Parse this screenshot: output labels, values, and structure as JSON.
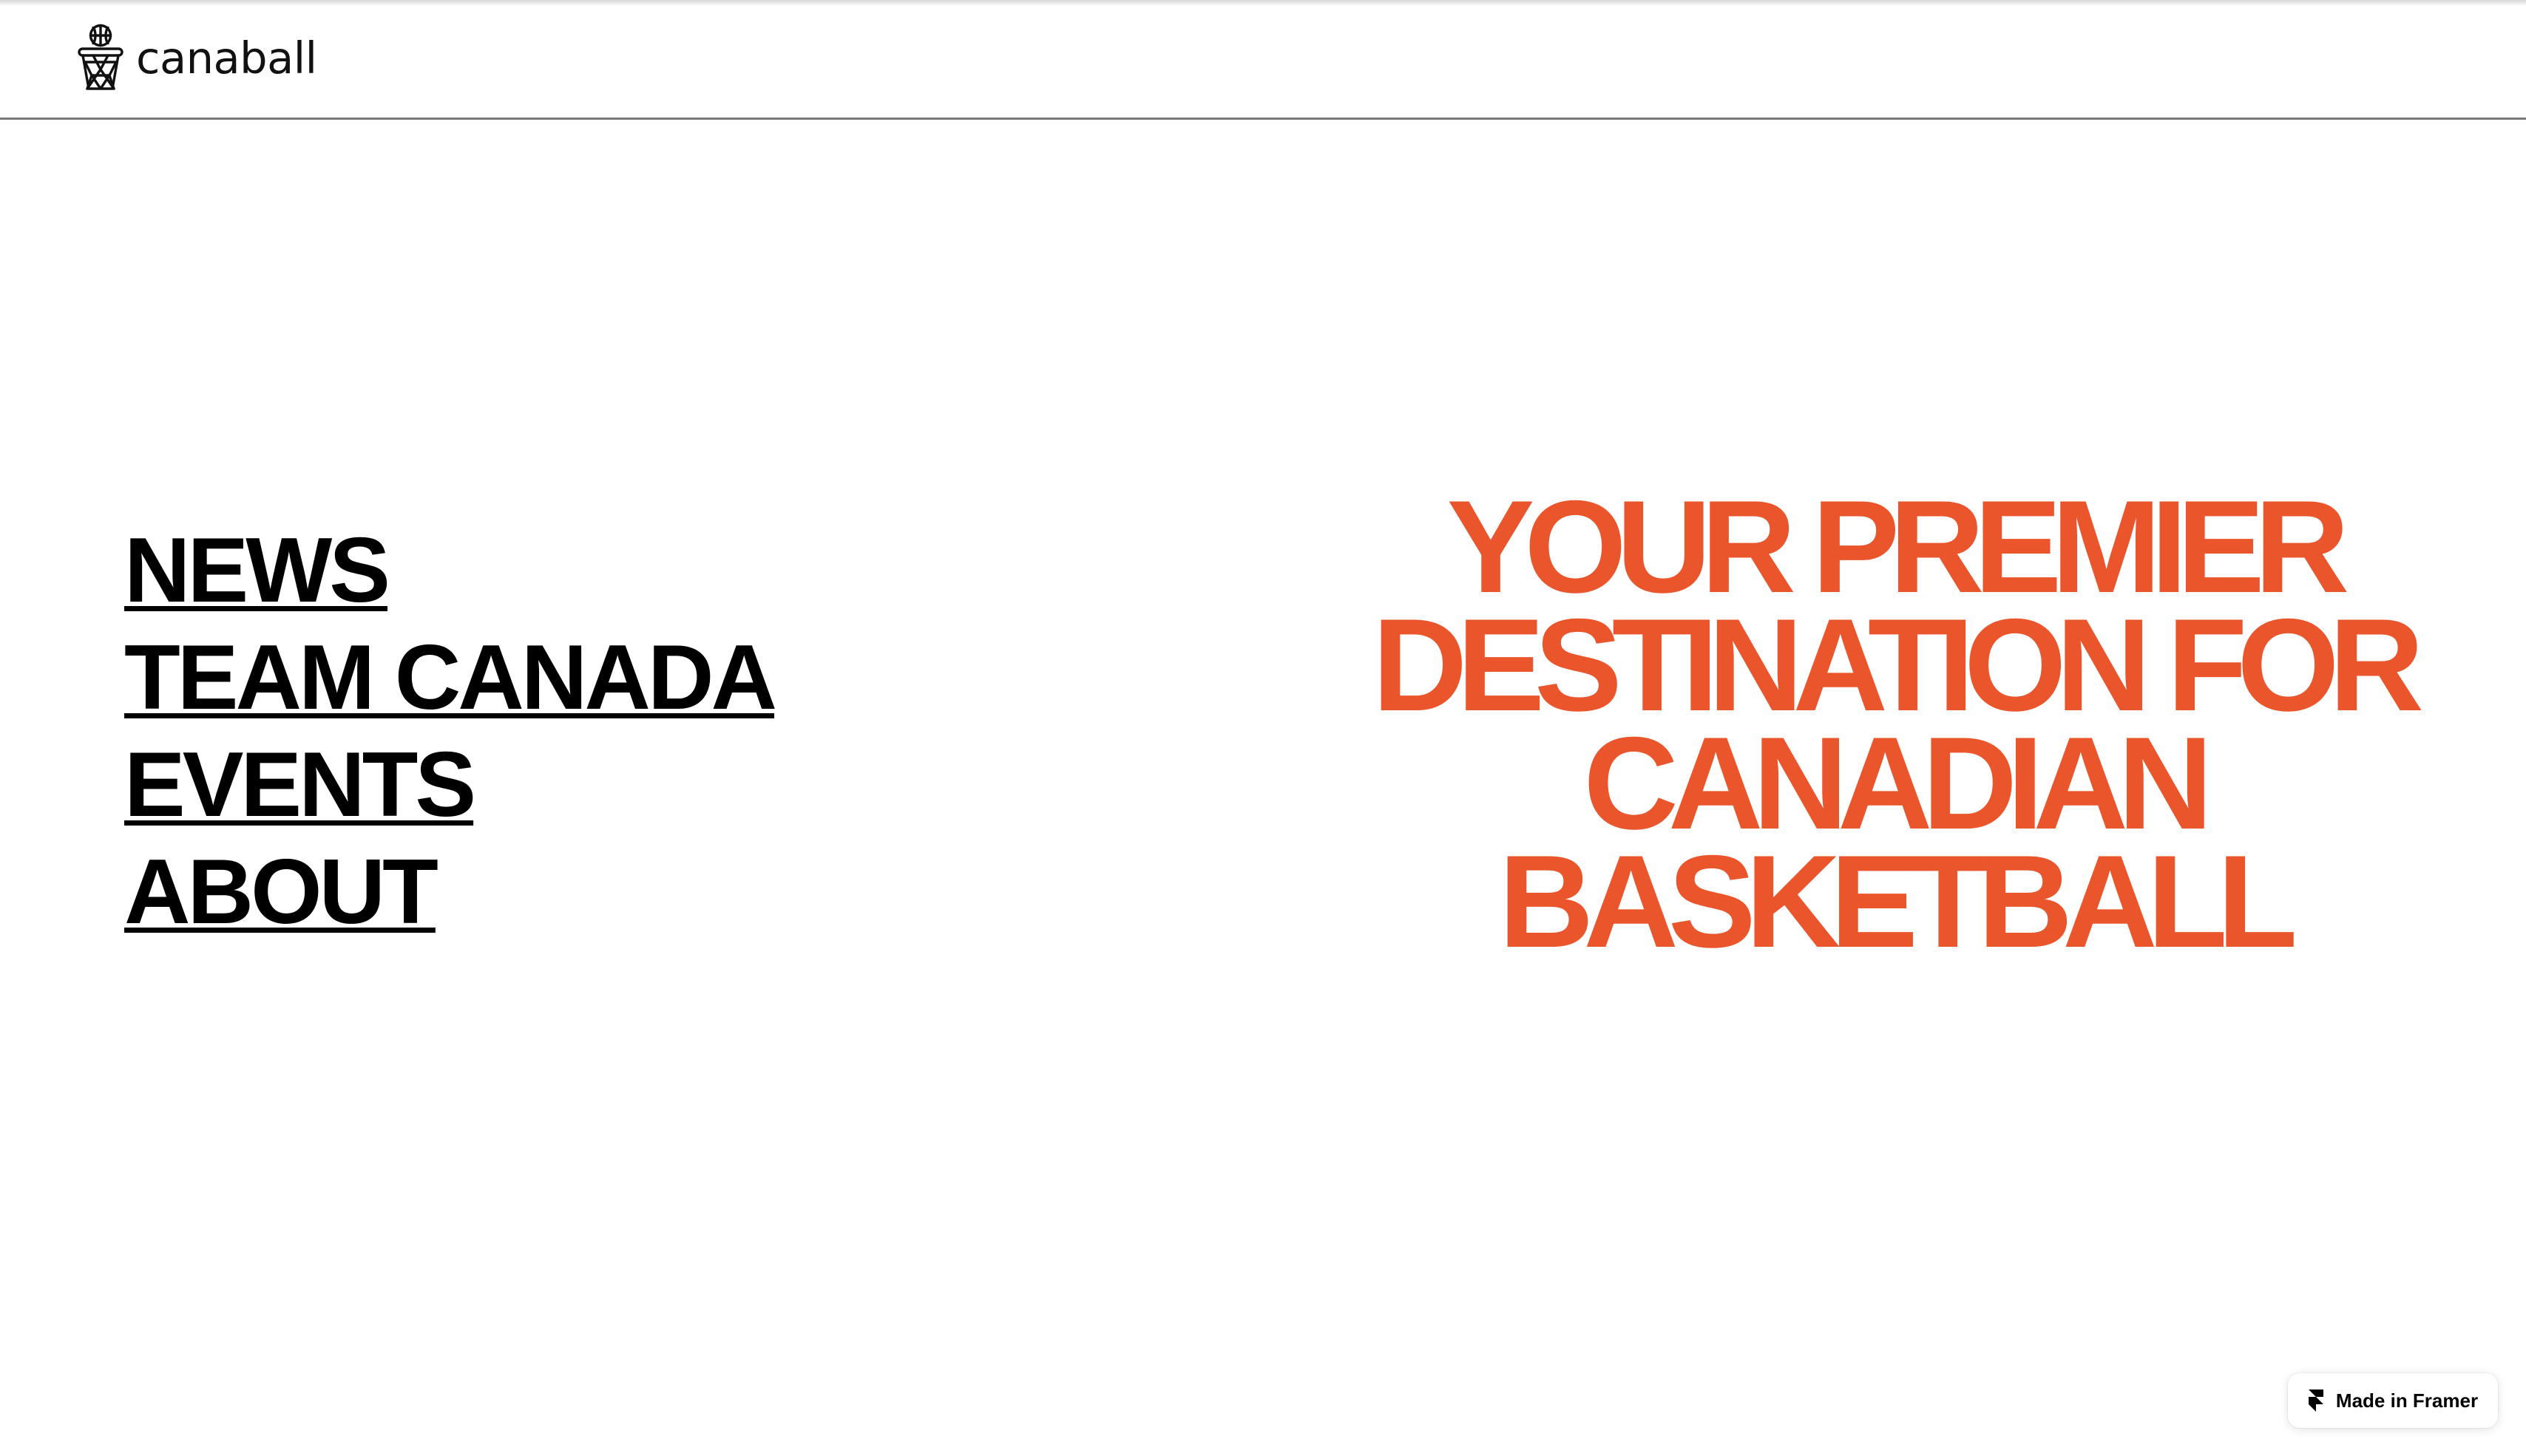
{
  "header": {
    "brand_name": "canaball",
    "logo_icon": "basketball-hoop-icon"
  },
  "nav": {
    "items": [
      {
        "label": "NEWS"
      },
      {
        "label": "TEAM CANADA"
      },
      {
        "label": "EVENTS"
      },
      {
        "label": "ABOUT"
      }
    ]
  },
  "hero": {
    "headline": "YOUR PREMIER DESTINATION FOR CANADIAN BASKETBALL"
  },
  "badge": {
    "label": "Made in Framer",
    "icon": "framer-logo-icon"
  },
  "colors": {
    "accent": "#ea552b",
    "text": "#000000",
    "background": "#ffffff"
  }
}
